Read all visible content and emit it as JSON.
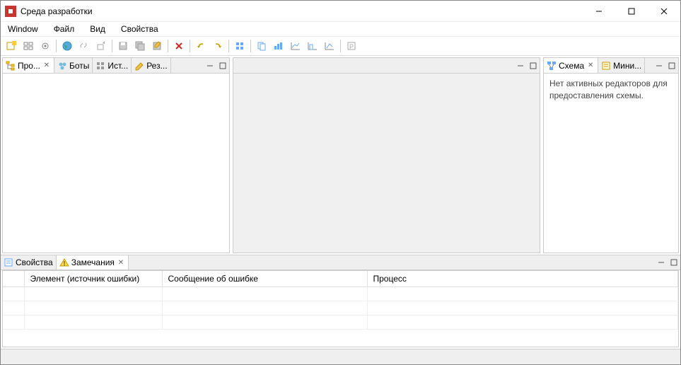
{
  "window": {
    "title": "Среда разработки"
  },
  "menu": {
    "window": "Window",
    "file": "Файл",
    "view": "Вид",
    "properties": "Свойства"
  },
  "left_panel": {
    "tabs": [
      "Про...",
      "Боты",
      "Ист...",
      "Рез..."
    ]
  },
  "right_panel": {
    "tabs": [
      "Схема",
      "Мини..."
    ],
    "message": "Нет активных редакторов для предоставления схемы."
  },
  "bottom_panel": {
    "tabs": [
      "Свойства",
      "Замечания"
    ],
    "columns": [
      "",
      "Элемент (источник ошибки)",
      "Сообщение об ошибке",
      "Процесс"
    ]
  }
}
